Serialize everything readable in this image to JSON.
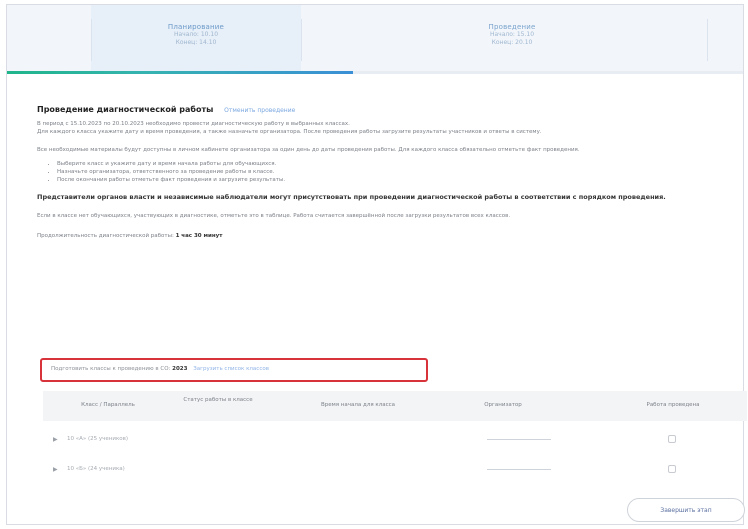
{
  "steps": [
    {
      "title": "Планирование",
      "line1": "Начало: 10.10",
      "line2": "Конец: 14.10"
    },
    {
      "title": "Проведение",
      "line1": "Начало: 15.10",
      "line2": "Конец: 20.10"
    }
  ],
  "progress": {
    "fraction": 0.47
  },
  "content": {
    "title": "Проведение диагностической работы",
    "title_link": "Отменить проведение",
    "para1": "В период с 15.10.2023 по 20.10.2023 необходимо провести диагностическую работу в выбранных классах.",
    "para1b": "Для каждого класса укажите дату и время проведения, а также назначьте организатора. После проведения работы загрузите результаты участников и ответы в систему.",
    "para2": "Все необходимые материалы будут доступны в личном кабинете организатора за один день до даты проведения работы. Для каждого класса обязательно отметьте факт проведения.",
    "bullets": [
      "Выберите класс и укажите дату и время начала работы для обучающихся.",
      "Назначьте организатора, ответственного за проведение работы в классе.",
      "После окончания работы отметьте факт проведения и загрузите результаты."
    ],
    "heading2": "Представители органов власти и независимые наблюдатели могут присутствовать при проведении диагностической работы в соответствии с порядком проведения.",
    "para3": "Если в классе нет обучающихся, участвующих в диагностике, отметьте это в таблице. Работа считается завершённой после загрузки результатов всех классов.",
    "para4_prefix": "Продолжительность диагностической работы:",
    "para4_value": "1 час 30 минут",
    "highlight_text_prefix": "Подготовить классы к проведению в СО:",
    "highlight_value": "2023",
    "highlight_link": "Загрузить список классов"
  },
  "table": {
    "headers": [
      "Класс / Параллель",
      "Статус работы в классе",
      "Время начала для класса",
      "Организатор",
      "Работа проведена"
    ],
    "rows": [
      {
        "label": "10 «А» (25 учеников)"
      },
      {
        "label": "10 «Б» (24 ученика)"
      }
    ]
  },
  "finish_button": "Завершить этап"
}
